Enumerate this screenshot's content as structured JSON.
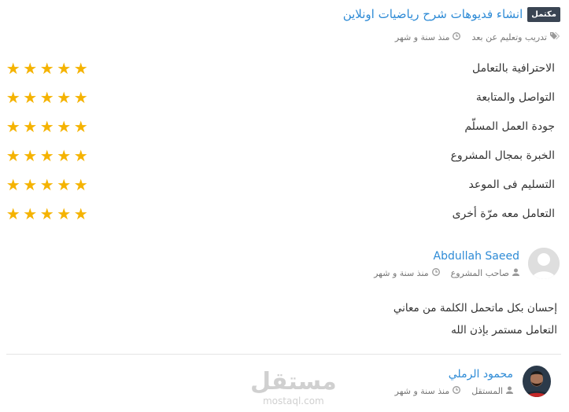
{
  "project": {
    "status_badge": "مكتمل",
    "title": "انشاء فديوهات شرح رياضيات اونلاين",
    "category": "تدريب وتعليم عن بعد",
    "time": "منذ سنة و شهر"
  },
  "criteria": [
    {
      "label": "الاحترافية بالتعامل",
      "stars": 5
    },
    {
      "label": "التواصل والمتابعة",
      "stars": 5
    },
    {
      "label": "جودة العمل المسلّم",
      "stars": 5
    },
    {
      "label": "الخبرة بمجال المشروع",
      "stars": 5
    },
    {
      "label": "التسليم فى الموعد",
      "stars": 5
    },
    {
      "label": "التعامل معه مرّة أخرى",
      "stars": 5
    }
  ],
  "owner_review": {
    "name": "Abdullah Saeed",
    "role": "صاحب المشروع",
    "time": "منذ سنة و شهر",
    "lines": [
      "إحسان بكل ماتحمل الكلمة من معاني",
      "التعامل مستمر بإذن الله"
    ]
  },
  "freelancer": {
    "name": "محمود الرملي",
    "role": "المستقل",
    "time": "منذ سنة و شهر"
  },
  "watermark": {
    "logo_text": "مستقل",
    "domain": "mostaql.com"
  },
  "colors": {
    "link": "#2e8bd6",
    "star": "#f5b301",
    "badge_bg": "#3a4553"
  },
  "icons": {
    "tags": "tags-icon",
    "clock": "clock-icon",
    "user": "user-icon",
    "star": "star-icon"
  }
}
